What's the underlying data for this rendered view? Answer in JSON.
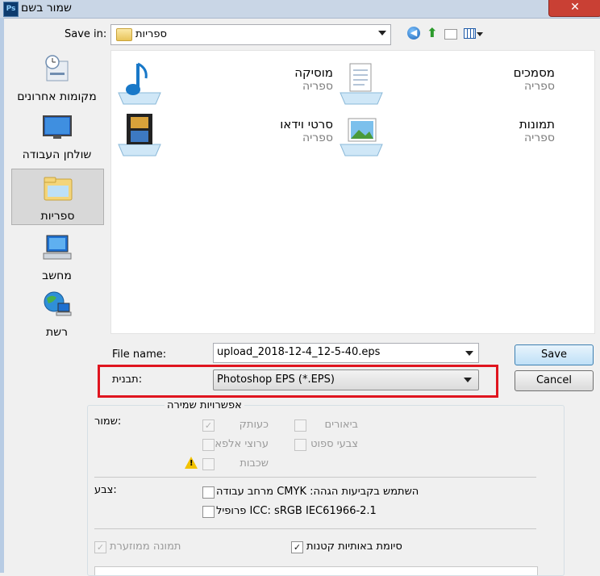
{
  "window": {
    "title": "שמור בשם",
    "app_badge": "Ps",
    "close_glyph": "✕"
  },
  "save_in": {
    "label": "Save in:",
    "value": "ספריות"
  },
  "places": [
    {
      "label": "מקומות אחרונים",
      "icon": "recent-places-icon",
      "selected": false
    },
    {
      "label": "שולחן העבודה",
      "icon": "desktop-icon",
      "selected": false
    },
    {
      "label": "ספריות",
      "icon": "libraries-icon",
      "selected": true
    },
    {
      "label": "מחשב",
      "icon": "computer-icon",
      "selected": false
    },
    {
      "label": "רשת",
      "icon": "network-icon",
      "selected": false
    }
  ],
  "libraries": [
    {
      "name": "מוסיקה",
      "type": "ספריה",
      "icon": "music-library-icon"
    },
    {
      "name": "מסמכים",
      "type": "ספריה",
      "icon": "documents-library-icon"
    },
    {
      "name": "סרטי וידאו",
      "type": "ספריה",
      "icon": "videos-library-icon"
    },
    {
      "name": "תמונות",
      "type": "ספריה",
      "icon": "pictures-library-icon"
    }
  ],
  "file_name": {
    "label": "File name:",
    "value": "upload_2018-12-4_12-5-40.eps"
  },
  "format": {
    "label": "תבנית:",
    "value": "Photoshop EPS (*.EPS)"
  },
  "buttons": {
    "save": "Save",
    "cancel": "Cancel"
  },
  "options": {
    "legend": "אפשרויות שמירה",
    "save_label": "שמור:",
    "color_label": "צבע:",
    "copy": {
      "label": "כעותק",
      "checked": true,
      "disabled": true
    },
    "notes": {
      "label": "ביאורים",
      "checked": false,
      "disabled": true
    },
    "alpha": {
      "label": "ערוצי אלפא",
      "checked": false,
      "disabled": true
    },
    "spot": {
      "label": "צבעי ספוט",
      "checked": false,
      "disabled": true
    },
    "layers": {
      "label": "שכבות",
      "checked": false,
      "disabled": true
    },
    "proof": {
      "label": "מרחב עבודה CMYK :השתמש בקביעות הגהה",
      "checked": false,
      "disabled": false
    },
    "icc": {
      "label": "פרופיל ICC: sRGB IEC61966-2.1",
      "checked": false,
      "disabled": false
    },
    "thumbnail": {
      "label": "תמונה ממוזערת",
      "checked": true,
      "disabled": true
    },
    "lowercase": {
      "label": "סיומת באותיות קטנות",
      "checked": true,
      "disabled": false
    }
  },
  "colors": {
    "highlight": "#e0151f",
    "titlebar": "#c9d6e6",
    "close": "#c94034"
  }
}
